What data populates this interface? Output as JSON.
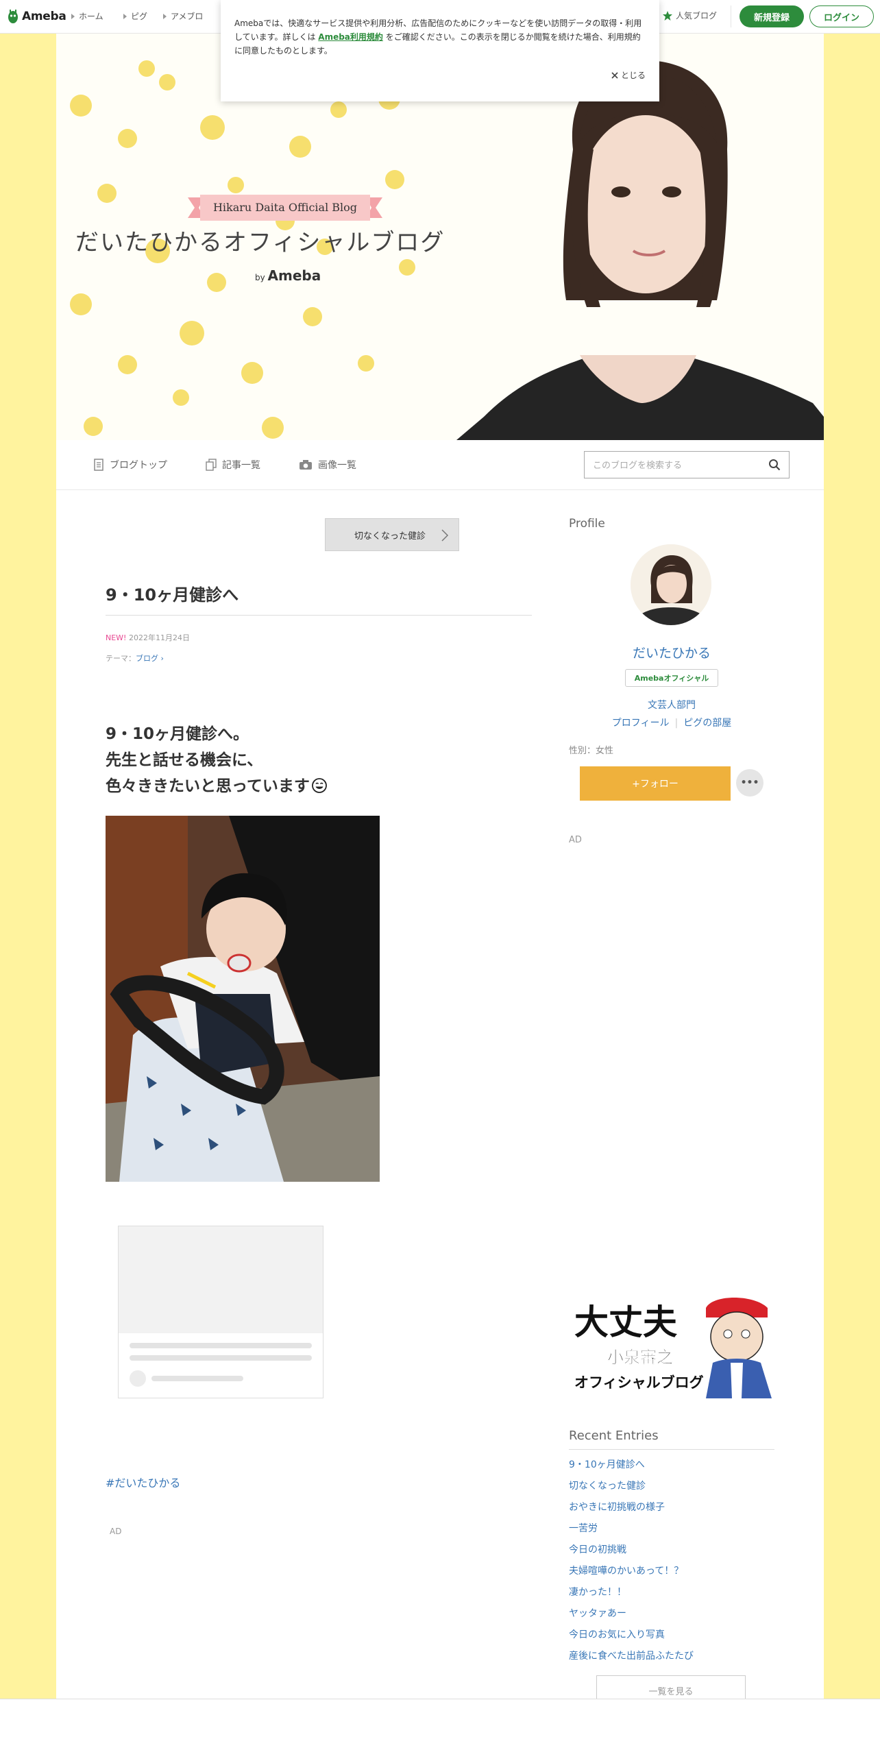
{
  "topbar": {
    "logo": "Ameba",
    "nav": [
      "ホーム",
      "ピグ",
      "アメブロ"
    ],
    "popular": "人気ブログ",
    "signup": "新規登録",
    "login": "ログイン"
  },
  "cookie": {
    "text_before": "Amebaでは、快適なサービス提供や利用分析、広告配信のためにクッキーなどを使い訪問データの取得・利用しています。詳しくは",
    "link": "Ameba利用規約",
    "text_after": "をご確認ください。この表示を閉じるか閲覧を続けた場合、利用規約に同意したものとします。",
    "close": "とじる"
  },
  "header": {
    "ribbon": "Hikaru Daita Official Blog",
    "title": "だいたひかるオフィシャルブログ",
    "by": "by",
    "by_brand": "Ameba"
  },
  "subnav": {
    "items": [
      "ブログトップ",
      "記事一覧",
      "画像一覧"
    ],
    "search_placeholder": "このブログを検索する"
  },
  "entry": {
    "prev": "切なくなった健診",
    "title": "9・10ヶ月健診へ",
    "new_label": "NEW!",
    "date": "2022年11月24日",
    "theme_label": "テーマ：",
    "theme": "ブログ",
    "body": [
      "9・10ヶ月健診へ。",
      "先生と話せる機会に、",
      "色々ききたいと思っています"
    ],
    "hashtag": "#だいたひかる",
    "ad": "AD"
  },
  "profile": {
    "heading": "Profile",
    "name": "だいたひかる",
    "badge": "Amebaオフィシャル",
    "category": "文芸人部門",
    "link_profile": "プロフィール",
    "link_room": "ピグの部屋",
    "gender": "性別：女性",
    "follow": "+フォロー",
    "more": "•••",
    "ad": "AD"
  },
  "banner": {
    "line1": "大丈夫",
    "line2": "小泉審之",
    "line3": "オフィシャルブログ"
  },
  "recent": {
    "heading": "Recent Entries",
    "items": [
      "9・10ヶ月健診へ",
      "切なくなった健診",
      "おやきに初挑戦の様子",
      "一苦労",
      "今日の初挑戦",
      "夫婦喧嘩のかいあって！？",
      "凄かった！！",
      "ヤッタァあー",
      "今日のお気に入り写真",
      "産後に食べた出前品ふたたび"
    ],
    "see_all": "一覧を見る"
  },
  "colors": {
    "accent_green": "#2d8c3c",
    "link_blue": "#3876b6",
    "follow_orange": "#efb13c",
    "side_yellow": "#fff39e"
  }
}
